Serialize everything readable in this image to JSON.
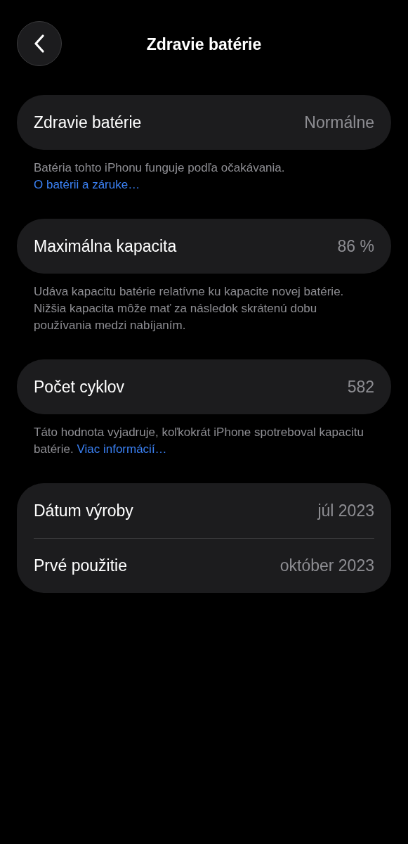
{
  "title": "Zdravie batérie",
  "sections": [
    {
      "rows": [
        {
          "label": "Zdravie batérie",
          "value": "Normálne"
        }
      ],
      "footer": {
        "text": "Batéria tohto iPhonu funguje podľa očakávania.",
        "link": "O batérii a záruke…"
      }
    },
    {
      "rows": [
        {
          "label": "Maximálna kapacita",
          "value": "86 %"
        }
      ],
      "footer": {
        "text": "Udáva kapacitu batérie relatívne ku kapacite novej batérie. Nižšia kapacita môže mať za následok skrátenú dobu používania medzi nabíjaním."
      }
    },
    {
      "rows": [
        {
          "label": "Počet cyklov",
          "value": "582"
        }
      ],
      "footer": {
        "text": "Táto hodnota vyjadruje, koľkokrát iPhone spotreboval kapacitu batérie.",
        "link": "Viac informácií…"
      }
    },
    {
      "rows": [
        {
          "label": "Dátum výroby",
          "value": "júl 2023"
        },
        {
          "label": "Prvé použitie",
          "value": "október 2023"
        }
      ]
    }
  ]
}
